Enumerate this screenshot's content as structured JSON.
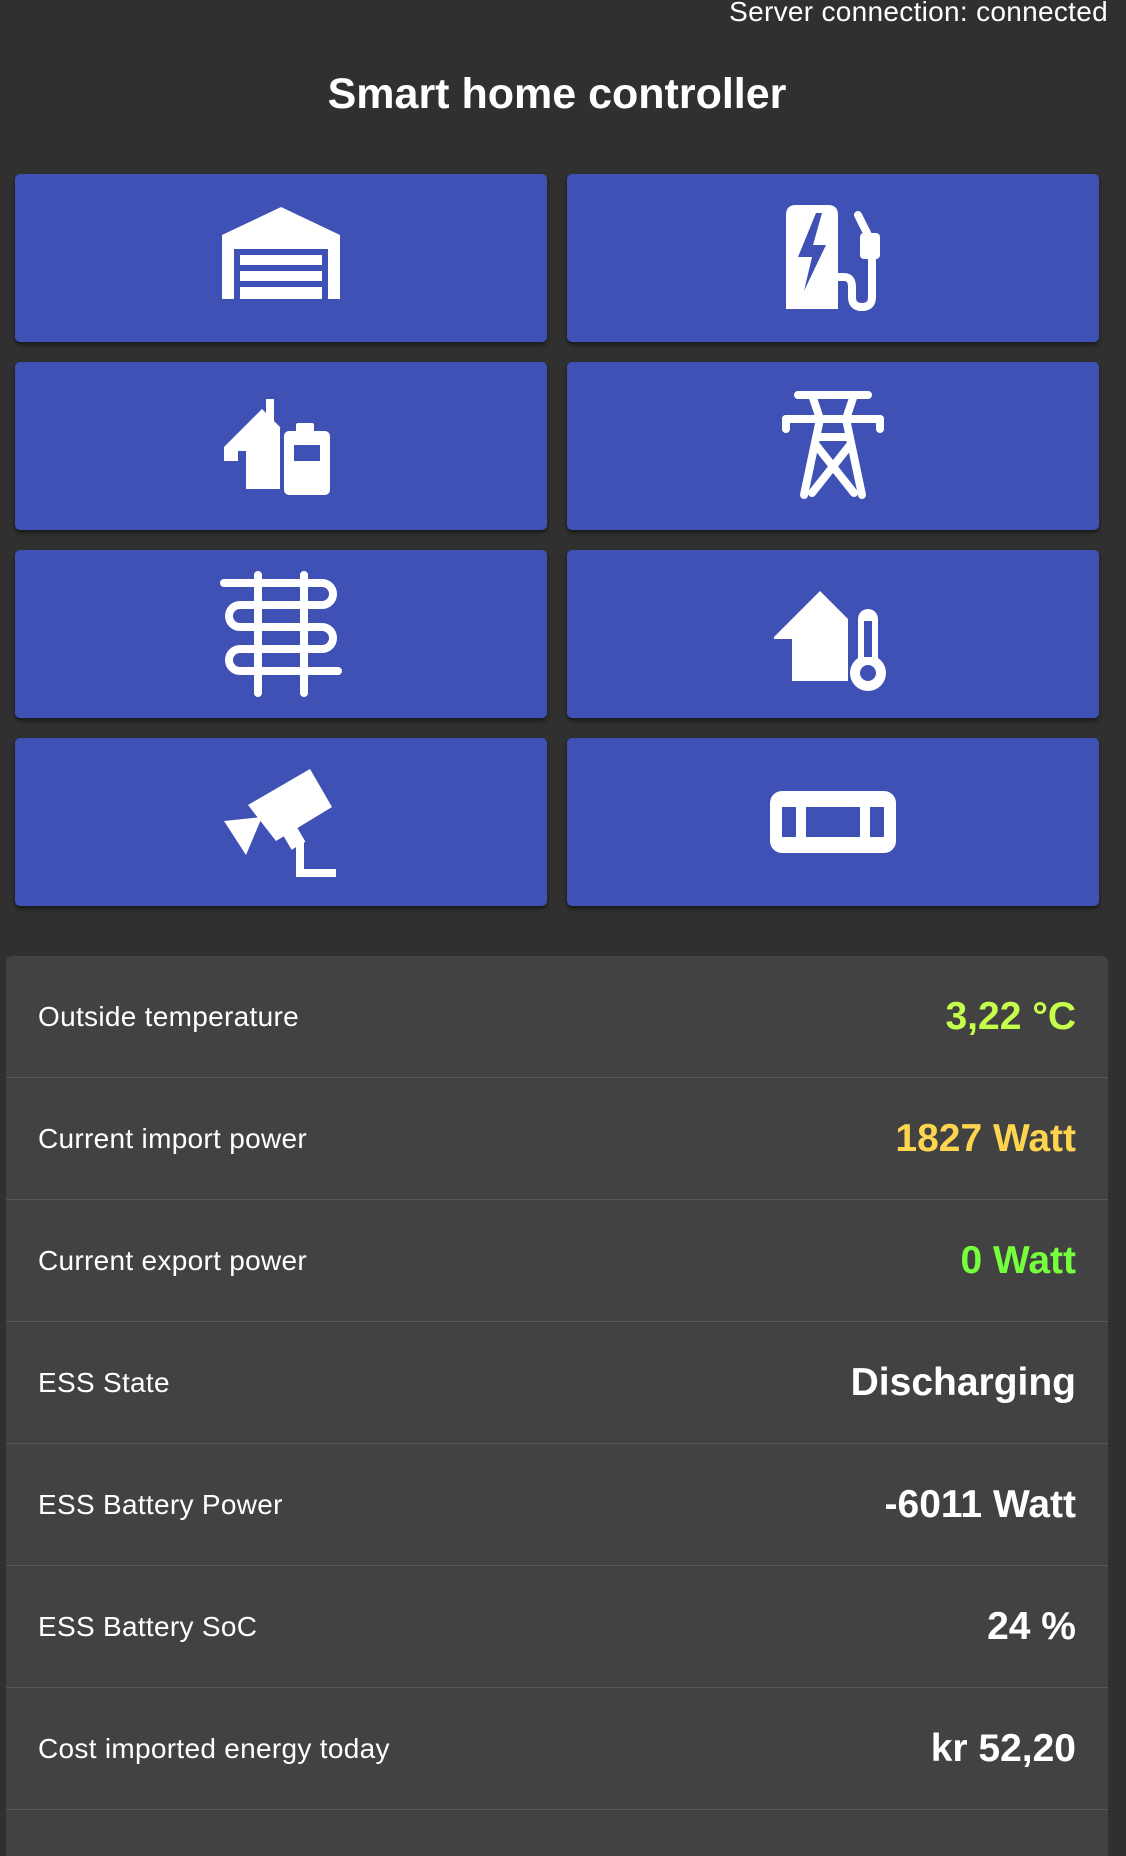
{
  "header": {
    "server_status": "Server connection: connected",
    "title": "Smart home controller"
  },
  "tiles": [
    {
      "icon": "garage-icon"
    },
    {
      "icon": "ev-charger-icon"
    },
    {
      "icon": "home-battery-icon"
    },
    {
      "icon": "power-pylon-icon"
    },
    {
      "icon": "floor-heating-icon"
    },
    {
      "icon": "home-thermometer-icon"
    },
    {
      "icon": "security-camera-icon"
    },
    {
      "icon": "fuse-icon"
    }
  ],
  "colors": {
    "tile_background": "#3f51b5",
    "page_background": "#303030",
    "panel_background": "#424242",
    "temperature": "#c6ff4a",
    "import": "#ffd54f",
    "export": "#76ff3b",
    "default_value": "#ffffff"
  },
  "info": [
    {
      "label": "Outside temperature",
      "value": "3,22 °C",
      "color": "#c6ff4a"
    },
    {
      "label": "Current import power",
      "value": "1827 Watt",
      "color": "#ffd54f"
    },
    {
      "label": "Current export power",
      "value": "0 Watt",
      "color": "#76ff3b"
    },
    {
      "label": "ESS State",
      "value": "Discharging",
      "color": "#ffffff"
    },
    {
      "label": "ESS Battery Power",
      "value": "-6011 Watt",
      "color": "#ffffff"
    },
    {
      "label": "ESS Battery SoC",
      "value": "24 %",
      "color": "#ffffff"
    },
    {
      "label": "Cost imported energy today",
      "value": "kr 52,20",
      "color": "#ffffff"
    }
  ]
}
